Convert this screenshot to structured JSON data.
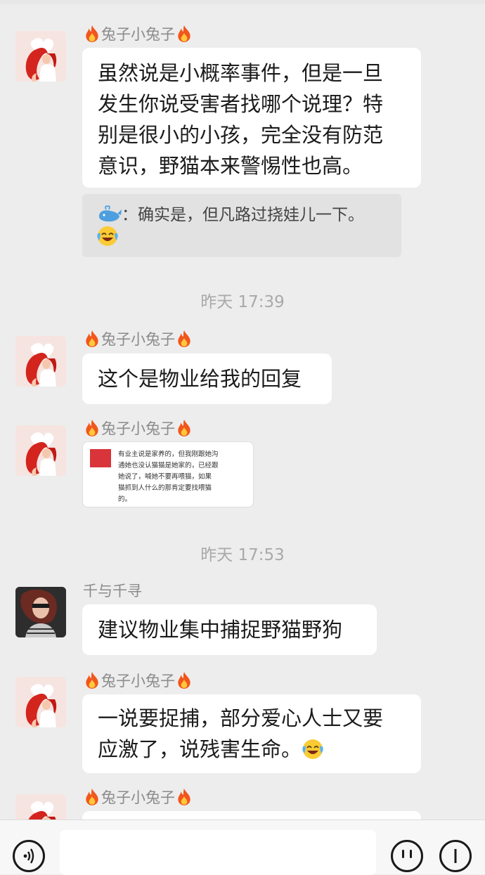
{
  "messages": [
    {
      "sender": "兔子小兔子",
      "text": "虽然说是小概率事件，但是一旦发生你说受害者找哪个说理？特别是很小的小孩，完全没有防范意识，野猫本来警惕性也高。"
    },
    {
      "quote": "：确实是，但凡路过挠娃儿一下。"
    },
    {
      "time": "昨天 17:39"
    },
    {
      "sender": "兔子小兔子",
      "text": "这个是物业给我的回复"
    },
    {
      "sender": "兔子小兔子",
      "image_text": "有业主说是家养的，但我刚跟她沟通她也没认猫猫是她家的，已经跟她说了，喊她不要再喂猫，如果猫抓到人什么的那肯定要找喂猫的。"
    },
    {
      "time": "昨天 17:53"
    },
    {
      "sender": "千与千寻",
      "text": "建议物业集中捕捉野猫野狗"
    },
    {
      "sender": "兔子小兔子",
      "text": "一说要捉捕，部分爱心人士又要应激了，说残害生命。"
    },
    {
      "sender": "兔子小兔子"
    }
  ],
  "lines": {
    "m1": [
      "虽然说是小概率事件，但是一旦",
      "发生你说受害者找哪个说理？特",
      "别是很小的小孩，完全没有防范",
      "意识，野猫本来警惕性也高。"
    ],
    "m6": [
      "一说要捉捕，部分爱心人士又要",
      "应激了，说残害生命。"
    ],
    "img": [
      "有业主说是家养的，但我刚跟她沟",
      "通她也没认猫猫是她家的，已经跟",
      "她说了，喊她不要再喂猫，如果",
      "猫抓到人什么的那肯定要找喂猫",
      "的。"
    ]
  },
  "icons": {
    "voice": "voice-icon",
    "emoji": "emoji-icon",
    "plus": "plus-icon",
    "flame": "fire-icon",
    "whale": "whale-icon",
    "laugh": "laughing-crying-emoji"
  },
  "colors": {
    "background": "#ededed",
    "bubble": "#ffffff",
    "quote": "#e2e2e2",
    "meta_text": "#8b8b8b"
  }
}
